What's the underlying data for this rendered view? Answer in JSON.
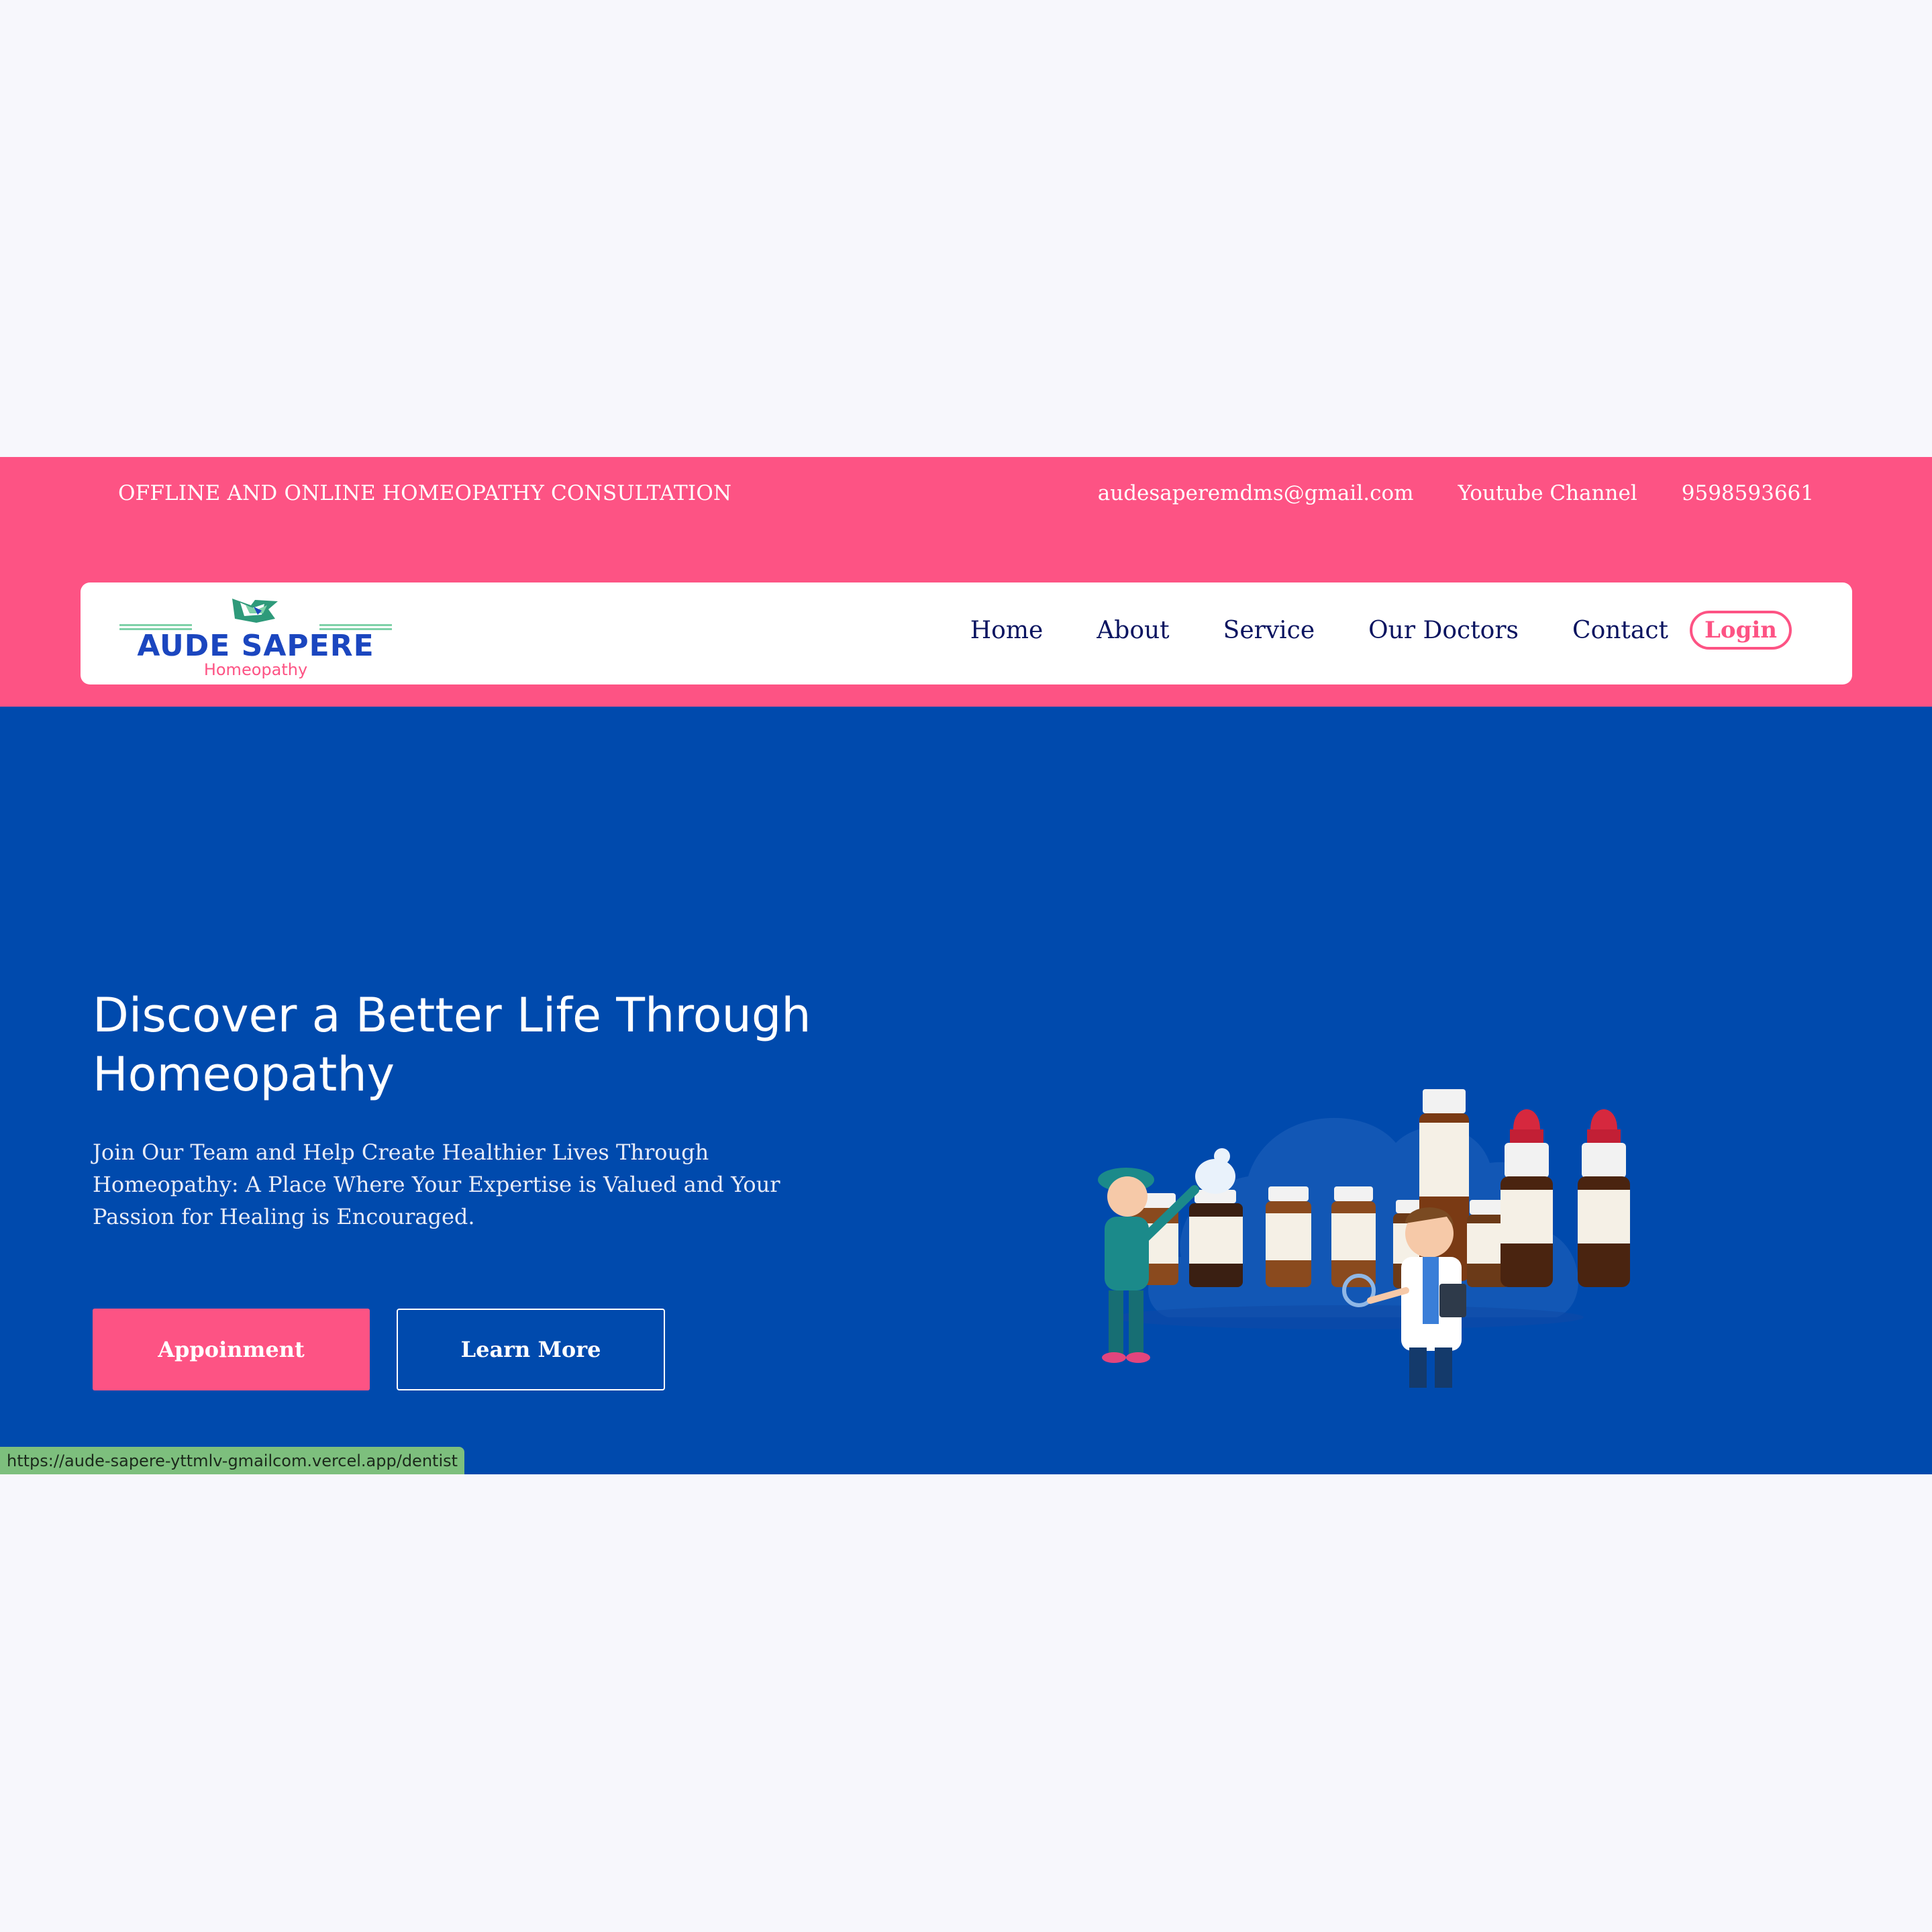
{
  "topbar": {
    "tagline": "OFFLINE AND ONLINE HOMEOPATHY CONSULTATION",
    "email": "audesaperemdms@gmail.com",
    "youtube": "Youtube Channel",
    "phone": "9598593661"
  },
  "logo": {
    "name": "AUDE SAPERE",
    "subtitle": "Homeopathy",
    "icon": "teal-tag-icon"
  },
  "nav": {
    "items": [
      {
        "label": "Home"
      },
      {
        "label": "About"
      },
      {
        "label": "Service"
      },
      {
        "label": "Our Doctors"
      },
      {
        "label": "Contact"
      }
    ],
    "login_label": "Login"
  },
  "hero": {
    "title": "Discover a Better Life Through Homeopathy",
    "description": "Join Our Team and Help Create Healthier Lives Through Homeopathy: A Place Where Your Expertise is Valued and Your Passion for Healing is Encouraged.",
    "primary_button": "Appoinment",
    "secondary_button": "Learn More",
    "illustration": "doctors-with-homeopathy-bottles-illustration"
  },
  "status_url": "https://aude-sapere-yttmlv-gmailcom.vercel.app/dentist",
  "colors": {
    "pink": "#fd5384",
    "hero_blue": "#004aad",
    "navy_text": "#0a1460",
    "logo_blue": "#1b46bf",
    "logo_green": "#7ed1a8",
    "page_bg": "#f7f7fc"
  }
}
